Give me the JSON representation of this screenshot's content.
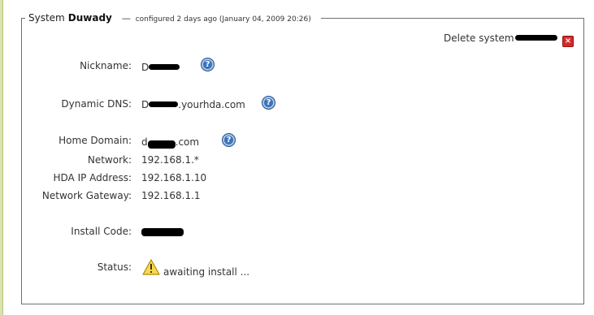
{
  "legend": {
    "prefix": "System",
    "name": "Duwady",
    "dash": "—",
    "configured": "configured 2 days ago (January 04, 2009 20:26)"
  },
  "delete": {
    "label": "Delete system"
  },
  "fields": {
    "nickname": {
      "label": "Nickname:",
      "value_prefix": "D"
    },
    "dynamic_dns": {
      "label": "Dynamic DNS:",
      "value_prefix": "D",
      "value_suffix": ".yourhda.com"
    },
    "home_domain": {
      "label": "Home Domain:",
      "value_prefix": "d",
      "value_suffix": ".com"
    },
    "network": {
      "label": "Network:",
      "value": "192.168.1.*"
    },
    "hda_ip": {
      "label": "HDA IP Address:",
      "value": "192.168.1.10"
    },
    "gateway": {
      "label": "Network Gateway:",
      "value": "192.168.1.1"
    },
    "install_code": {
      "label": "Install Code:"
    },
    "status": {
      "label": "Status:",
      "value": "awaiting install ..."
    }
  },
  "icons": {
    "help": "help-icon",
    "help_glyph": "?",
    "delete": "delete-icon",
    "delete_glyph": "×",
    "status": "warning-icon"
  },
  "colors": {
    "border": "#6f6f6f",
    "help_blue": "#3e73b8",
    "delete_red": "#d62828",
    "warning_yellow": "#f7d94c"
  }
}
